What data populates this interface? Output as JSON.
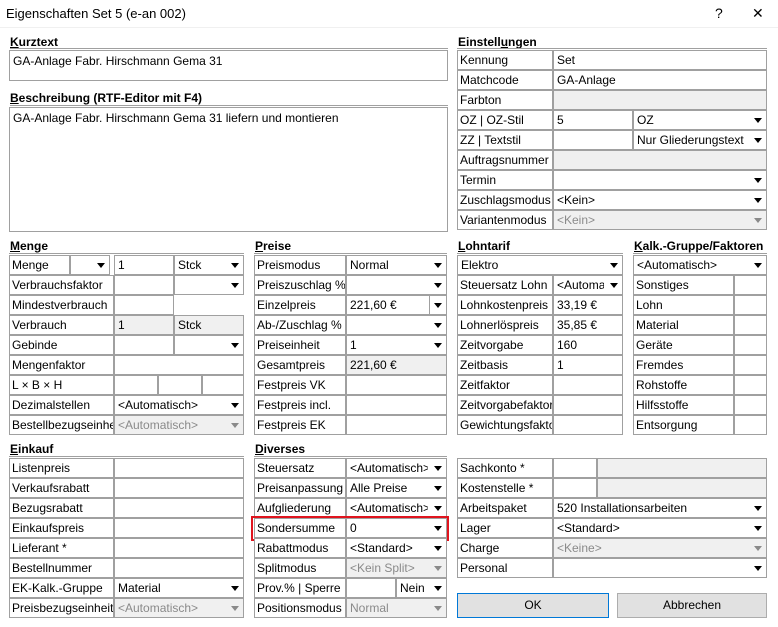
{
  "window": {
    "title": "Eigenschaften Set 5 (e-an 002)",
    "help_symbol": "?",
    "close_symbol": "✕"
  },
  "kurztext": {
    "heading_u": "K",
    "heading_rest": "urztext",
    "value": "GA-Anlage Fabr. Hirschmann Gema 31"
  },
  "beschreibung": {
    "heading_u": "B",
    "heading_rest": "eschreibung (RTF-Editor mit F4)",
    "value": "GA-Anlage Fabr. Hirschmann Gema 31 liefern und montieren"
  },
  "einstellungen": {
    "heading_pre": "Einstell",
    "heading_u": "u",
    "heading_rest": "ngen",
    "kennung": {
      "label": "Kennung",
      "value": "Set"
    },
    "matchcode": {
      "label": "Matchcode",
      "value": "GA-Anlage"
    },
    "farbton": {
      "label": "Farbton",
      "value": ""
    },
    "oz": {
      "label": "OZ | OZ-Stil",
      "value": "5",
      "style": "OZ"
    },
    "zz": {
      "label": "ZZ | Textstil",
      "value": "",
      "style": "Nur Gliederungstext"
    },
    "auftragsnummer": {
      "label": "Auftragsnummer",
      "value": ""
    },
    "termin": {
      "label": "Termin",
      "value": ""
    },
    "zuschlagsmodus": {
      "label": "Zuschlagsmodus",
      "value": "<Kein>"
    },
    "variantenmodus": {
      "label": "Variantenmodus",
      "value": "<Kein>"
    }
  },
  "menge": {
    "heading_u": "M",
    "heading_rest": "enge",
    "menge": {
      "label": "Menge",
      "value": "1",
      "unit": "Stck"
    },
    "verbrauchsfaktor": {
      "label": "Verbrauchsfaktor"
    },
    "mindestverbrauch": {
      "label": "Mindestverbrauch"
    },
    "verbrauch": {
      "label": "Verbrauch",
      "value": "1",
      "unit": "Stck"
    },
    "gebinde": {
      "label": "Gebinde"
    },
    "mengenfaktor": {
      "label": "Mengenfaktor"
    },
    "lbh": {
      "label": "L × B × H"
    },
    "dezimalstellen": {
      "label": "Dezimalstellen",
      "value": "<Automatisch>"
    },
    "bestellbezugseinheit": {
      "label": "Bestellbezugseinheit",
      "value": "<Automatisch>"
    }
  },
  "preise": {
    "heading_u": "P",
    "heading_rest": "reise",
    "preismodus": {
      "label": "Preismodus",
      "value": "Normal"
    },
    "preiszuschlag": {
      "label": "Preiszuschlag %",
      "value": ""
    },
    "einzelpreis": {
      "label": "Einzelpreis",
      "value": "221,60 €"
    },
    "abzuschlag": {
      "label": "Ab-/Zuschlag %",
      "value": ""
    },
    "preiseinheit": {
      "label": "Preiseinheit",
      "value": "1"
    },
    "gesamtpreis": {
      "label": "Gesamtpreis",
      "value": "221,60 €"
    },
    "festpreis_vk": {
      "label": "Festpreis VK"
    },
    "festpreis_incl": {
      "label": "Festpreis incl."
    },
    "festpreis_ek": {
      "label": "Festpreis EK"
    }
  },
  "lohntarif": {
    "heading_u": "L",
    "heading_rest": "ohntarif",
    "tarif": {
      "value": "Elektro"
    },
    "steuersatz_lohn": {
      "label": "Steuersatz Lohn",
      "value": "<Automat"
    },
    "lohnkostenpreis": {
      "label": "Lohnkostenpreis",
      "value": "33,19 €"
    },
    "lohnerloespreis": {
      "label": "Lohnerlöspreis",
      "value": "35,85 €"
    },
    "zeitvorgabe": {
      "label": "Zeitvorgabe",
      "value": "160"
    },
    "zeitbasis": {
      "label": "Zeitbasis",
      "value": "1"
    },
    "zeitfaktor": {
      "label": "Zeitfaktor",
      "value": ""
    },
    "zeitvorgabefaktor": {
      "label": "Zeitvorgabefaktor",
      "value": ""
    },
    "gewichtungsfaktor": {
      "label": "Gewichtungsfaktor",
      "value": ""
    }
  },
  "kalk": {
    "heading_u": "K",
    "heading_rest": "alk.-Gruppe/Faktoren",
    "gruppe": {
      "value": "<Automatisch>"
    },
    "items": [
      "Sonstiges",
      "Lohn",
      "Material",
      "Geräte",
      "Fremdes",
      "Rohstoffe",
      "Hilfsstoffe",
      "Entsorgung"
    ]
  },
  "einkauf": {
    "heading_u": "E",
    "heading_rest": "inkauf",
    "listenpreis": {
      "label": "Listenpreis"
    },
    "verkaufsrabatt": {
      "label": "Verkaufsrabatt"
    },
    "bezugsrabatt": {
      "label": "Bezugsrabatt"
    },
    "einkaufspreis": {
      "label": "Einkaufspreis"
    },
    "lieferant": {
      "label": "Lieferant *"
    },
    "bestellnummer": {
      "label": "Bestellnummer"
    },
    "ek_kalk_gruppe": {
      "label": "EK-Kalk.-Gruppe",
      "value": "Material"
    },
    "preisbezugseinheit": {
      "label": "Preisbezugseinheit",
      "value": "<Automatisch>"
    }
  },
  "diverses": {
    "heading_u": "D",
    "heading_rest": "iverses",
    "steuersatz": {
      "label": "Steuersatz",
      "value": "<Automatisch>"
    },
    "preisanpassung": {
      "label": "Preisanpassung",
      "value": "Alle Preise"
    },
    "aufgliederung": {
      "label": "Aufgliederung",
      "value": "<Automatisch>"
    },
    "sondersumme": {
      "label": "Sondersumme",
      "value": "0"
    },
    "rabattmodus": {
      "label": "Rabattmodus",
      "value": "<Standard>"
    },
    "splitmodus": {
      "label": "Splitmodus",
      "value": "<Kein Split>"
    },
    "prov_sperre": {
      "label": "Prov.% | Sperre",
      "value": "",
      "sperre": "Nein"
    },
    "positionsmodus": {
      "label": "Positionsmodus",
      "value": "Normal"
    }
  },
  "konto": {
    "sachkonto": {
      "label": "Sachkonto *"
    },
    "kostenstelle": {
      "label": "Kostenstelle *"
    },
    "arbeitspaket": {
      "label": "Arbeitspaket",
      "value": "520 Installationsarbeiten"
    },
    "lager": {
      "label": "Lager",
      "value": "<Standard>"
    },
    "charge": {
      "label": "Charge",
      "value": "<Keine>"
    },
    "personal": {
      "label": "Personal",
      "value": ""
    }
  },
  "buttons": {
    "ok": "OK",
    "cancel": "Abbrechen"
  },
  "colors": {
    "highlight": "#e0141e"
  }
}
